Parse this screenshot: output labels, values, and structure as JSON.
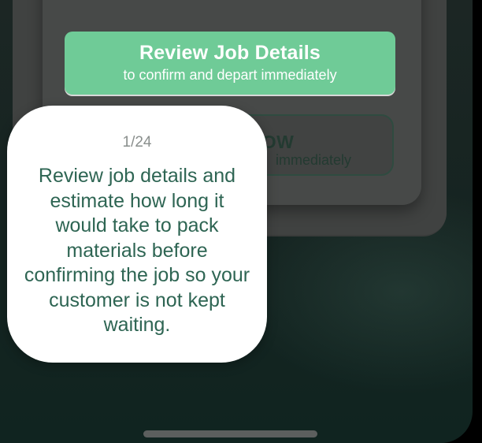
{
  "job_card": {
    "top_text": "",
    "primary_button": {
      "title": "Review Job Details",
      "subtitle": "to confirm and depart immediately"
    },
    "secondary_button": {
      "title_visible": "OW",
      "subtitle_visible": "immediately"
    }
  },
  "tooltip": {
    "counter": "1/24",
    "message": "Review job details and estimate how long it would take to pack materials before confirming the job so your customer is not kept waiting."
  },
  "colors": {
    "accent_green": "#6fcb97",
    "tooltip_text": "#2e6553",
    "background": "#152421"
  }
}
